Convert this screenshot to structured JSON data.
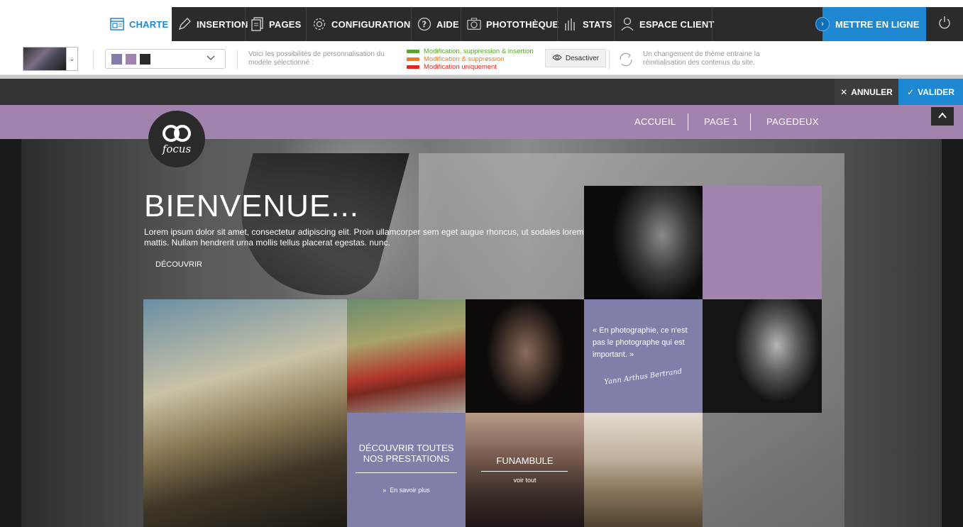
{
  "menu": {
    "items": [
      {
        "label": "CHARTE",
        "icon": "layout-icon",
        "active": true
      },
      {
        "label": "INSERTION",
        "icon": "pencil-icon"
      },
      {
        "label": "PAGES",
        "icon": "pages-icon"
      },
      {
        "label": "CONFIGURATION",
        "icon": "gear-icon"
      },
      {
        "label": "AIDE",
        "icon": "help-icon"
      },
      {
        "label": "PHOTOTHÈQUE",
        "icon": "camera-icon"
      },
      {
        "label": "STATS",
        "icon": "stats-icon"
      },
      {
        "label": "ESPACE CLIENT",
        "icon": "user-icon"
      }
    ],
    "publish_label": "METTRE EN LIGNE",
    "accent_color": "#1e88d2"
  },
  "toolbar": {
    "palette_colors": [
      "#7f7fa9",
      "#a183ad",
      "#2b2b2b"
    ],
    "customization_text": "Voici les possibilités de personnalisation du modèle sélectionné :",
    "legend": [
      {
        "label": "Modification, suppression & insertion",
        "color": "#5aa52a"
      },
      {
        "label": "Modification & suppression",
        "color": "#f07d1a"
      },
      {
        "label": "Modification uniquement",
        "color": "#e0261f"
      }
    ],
    "deactivate_label": "Desactiver",
    "theme_warning": "Un changement de thème entraine la réinitialisation des contenus du site."
  },
  "actions": {
    "cancel_label": "ANNULER",
    "validate_label": "VALIDER"
  },
  "site": {
    "nav": [
      "ACCUEIL",
      "PAGE 1",
      "PAGEDEUX"
    ],
    "logo_text": "focus",
    "hero": {
      "title": "BIENVENUE...",
      "text": "Lorem ipsum dolor sit amet, consectetur adipiscing elit. Proin ullamcorper sem eget augue rhoncus, ut sodales lorem mattis. Nullam hendrerit urna mollis tellus placerat egestas. nunc.",
      "cta": "DÉCOUVRIR"
    },
    "tiles": {
      "services_title": "DÉCOUVRIR TOUTES NOS PRESTATIONS",
      "services_link": "En savoir plus",
      "gallery_title": "FUNAMBULE",
      "gallery_link": "voir tout",
      "quote": "« En photographie, ce n'est pas le photographe qui est important. »",
      "quote_author": "Yann Arthus Bertrand"
    },
    "theme_colors": {
      "primary": "#a183ad",
      "secondary": "#7f7fa9"
    }
  }
}
